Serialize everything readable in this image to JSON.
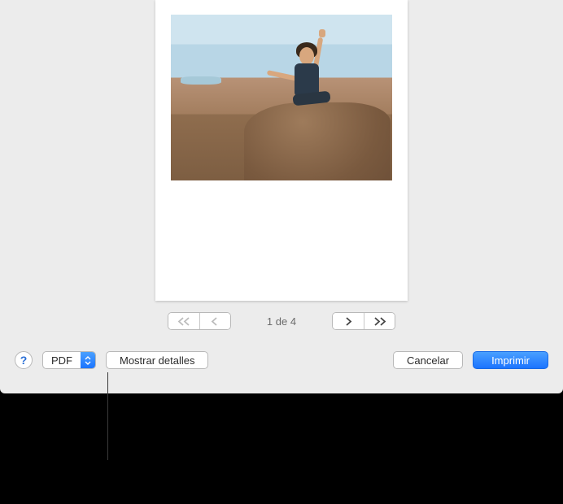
{
  "pager": {
    "indicator": "1 de 4"
  },
  "bottom": {
    "help_label": "?",
    "pdf_label": "PDF",
    "details_label": "Mostrar detalles",
    "cancel_label": "Cancelar",
    "print_label": "Imprimir"
  }
}
